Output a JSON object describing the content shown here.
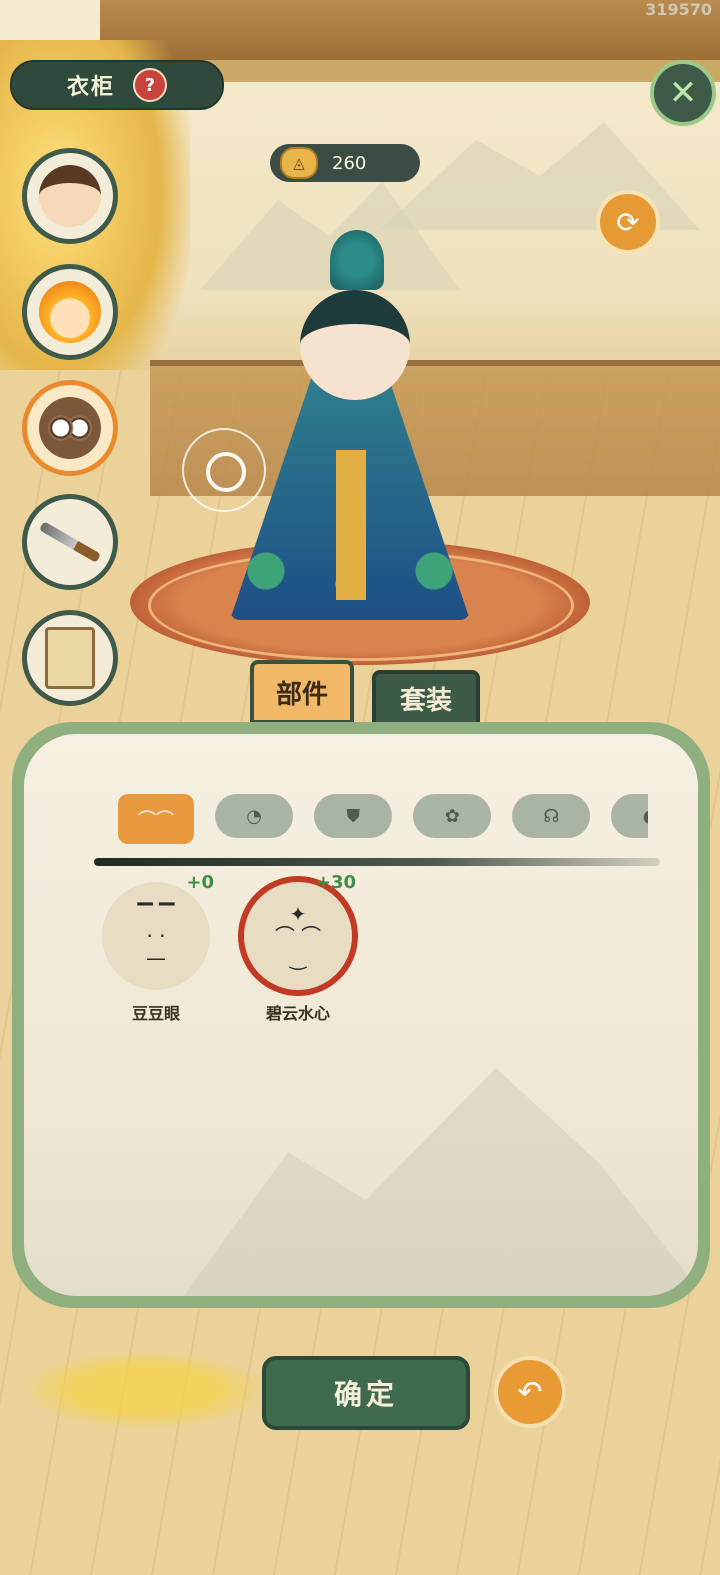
{
  "header": {
    "title": "衣柜",
    "help_icon": "question-icon",
    "close_icon": "close-icon",
    "uid": "319570"
  },
  "currency": {
    "icon": "coin-icon",
    "value": "260"
  },
  "side_menu": [
    {
      "name": "avatar-boy",
      "active": false
    },
    {
      "name": "avatar-fire-hair",
      "active": false
    },
    {
      "name": "avatar-owl",
      "active": true
    },
    {
      "name": "sword-item",
      "active": false
    },
    {
      "name": "scroll-item",
      "active": false
    }
  ],
  "tabs": [
    {
      "label": "部件",
      "active": true
    },
    {
      "label": "套装",
      "active": false
    }
  ],
  "categories": [
    {
      "glyph": "⌒⌒",
      "icon": "face-icon",
      "active": true
    },
    {
      "glyph": "◔",
      "icon": "hair-icon",
      "active": false
    },
    {
      "glyph": "⛊",
      "icon": "robe-icon",
      "active": false
    },
    {
      "glyph": "✿",
      "icon": "flower-icon",
      "active": false
    },
    {
      "glyph": "☊",
      "icon": "cloak-icon",
      "active": false
    },
    {
      "glyph": "◐",
      "icon": "more-icon",
      "active": false
    }
  ],
  "items": [
    {
      "name": "豆豆眼",
      "bonus": "+0",
      "face": "▔ ▔\n· ·\n—",
      "selected": false
    },
    {
      "name": "碧云水心",
      "bonus": "+30",
      "face": "✦\n⌒ ⌒\n‿",
      "selected": true
    }
  ],
  "actions": {
    "confirm_label": "确定",
    "undo_icon": "undo-icon"
  },
  "colors": {
    "accent_orange": "#e99a3e",
    "panel_green": "#8fb07e",
    "dark_green": "#3f6a4e"
  }
}
